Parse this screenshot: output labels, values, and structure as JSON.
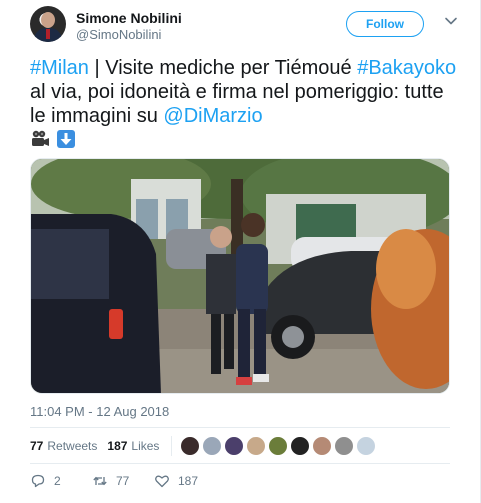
{
  "author": {
    "name": "Simone Nobilini",
    "handle": "@SimoNobilini"
  },
  "header": {
    "follow_label": "Follow"
  },
  "tweet": {
    "segments": [
      {
        "text": "#Milan",
        "kind": "link"
      },
      {
        "text": " | Visite mediche per Tiémoué ",
        "kind": "plain"
      },
      {
        "text": "#Bakayoko",
        "kind": "link"
      },
      {
        "text": " al via, poi idoneità e firma nel pomeriggio: tutte le immagini su ",
        "kind": "plain"
      },
      {
        "text": "@DiMarzio",
        "kind": "link"
      }
    ],
    "emojis": [
      "movie-camera-icon",
      "down-arrow-icon"
    ]
  },
  "timestamp": "11:04 PM - 12 Aug 2018",
  "stats": {
    "retweets_count": "77",
    "retweets_label": "Retweets",
    "likes_count": "187",
    "likes_label": "Likes"
  },
  "actions": {
    "replies": "2",
    "retweets": "77",
    "likes": "187"
  },
  "colors": {
    "accent": "#1da1f2",
    "text": "#14171a",
    "muted": "#657786"
  }
}
